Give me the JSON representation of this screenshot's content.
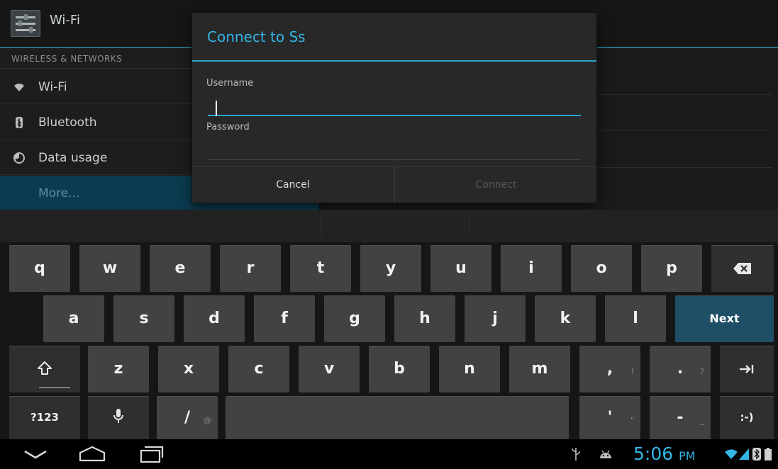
{
  "settings": {
    "app_title": "Wi-Fi",
    "section_header": "WIRELESS & NETWORKS",
    "items": [
      {
        "label": "Wi-Fi",
        "icon": "wifi-icon"
      },
      {
        "label": "Bluetooth",
        "icon": "bluetooth-icon"
      },
      {
        "label": "Data usage",
        "icon": "data-usage-icon"
      },
      {
        "label": "More...",
        "icon": ""
      }
    ],
    "selected_index": 3
  },
  "dialog": {
    "title": "Connect to Ss",
    "username_label": "Username",
    "username_value": "",
    "password_label": "Password",
    "password_value": "",
    "cancel_label": "Cancel",
    "connect_label": "Connect"
  },
  "keyboard": {
    "row1": [
      "q",
      "w",
      "e",
      "r",
      "t",
      "y",
      "u",
      "i",
      "o",
      "p"
    ],
    "row2": [
      "a",
      "s",
      "d",
      "f",
      "g",
      "h",
      "j",
      "k",
      "l"
    ],
    "row3": [
      "z",
      "x",
      "c",
      "v",
      "b",
      "n",
      "m"
    ],
    "next_label": "Next",
    "symbols_label": "?123",
    "slash_label": "/",
    "slash_hint": "@",
    "comma_label": ",",
    "comma_hint": "!",
    "period_label": ".",
    "period_hint": "?",
    "apostrophe_label": "'",
    "apostrophe_hint": "\"",
    "dash_label": "-",
    "dash_hint": "_",
    "smiley_label": ":-)"
  },
  "status": {
    "time": "5:06",
    "ampm": "PM"
  },
  "colors": {
    "accent": "#33b5e5",
    "selected_item_bg": "#0b3b4f",
    "next_key_bg": "#1f4f66"
  }
}
